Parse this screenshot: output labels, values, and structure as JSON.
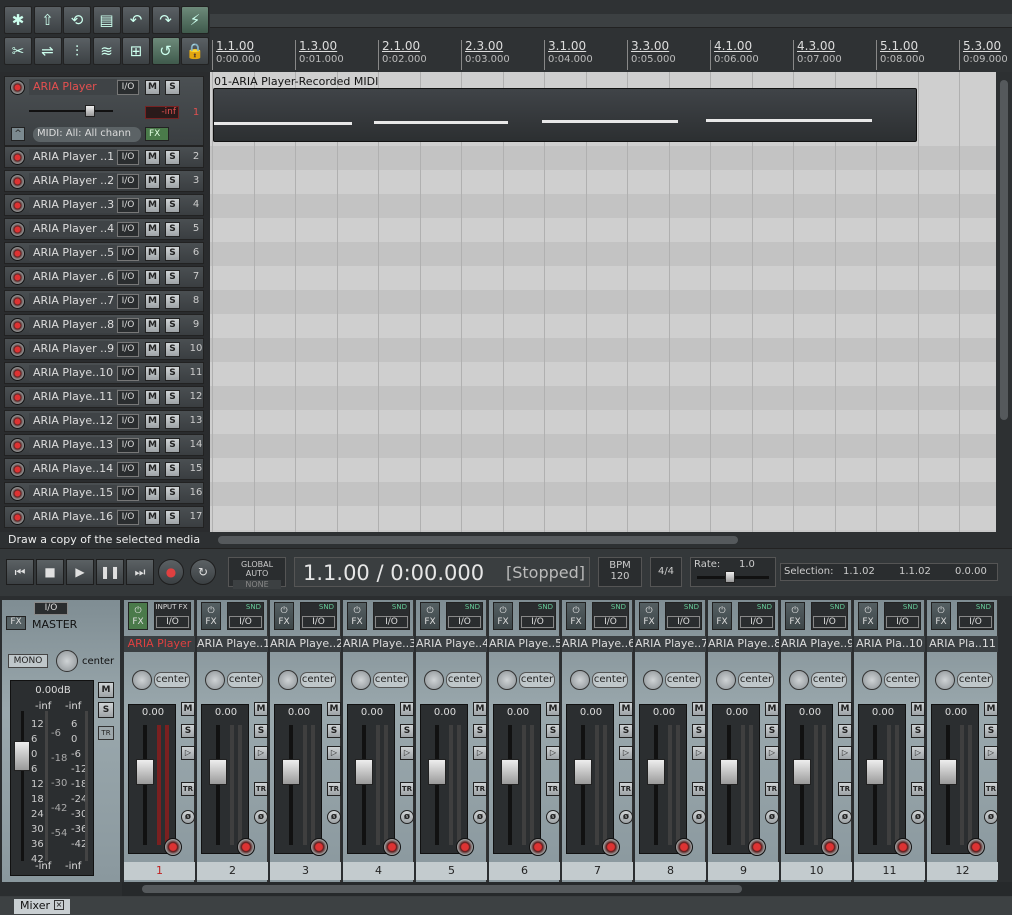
{
  "toolbar": {
    "icons": [
      "new-project",
      "open-project",
      "save-project",
      "project-settings",
      "undo",
      "redo",
      "auto-crossfade",
      "snap",
      "ripple-edit",
      "grid",
      "locking",
      "metronome",
      "loop",
      "lock"
    ]
  },
  "ruler": {
    "ticks": [
      {
        "bar": "1.1.00",
        "time": "0:00.000"
      },
      {
        "bar": "1.3.00",
        "time": "0:01.000"
      },
      {
        "bar": "2.1.00",
        "time": "0:02.000"
      },
      {
        "bar": "2.3.00",
        "time": "0:03.000"
      },
      {
        "bar": "3.1.00",
        "time": "0:04.000"
      },
      {
        "bar": "3.3.00",
        "time": "0:05.000"
      },
      {
        "bar": "4.1.00",
        "time": "0:06.000"
      },
      {
        "bar": "4.3.00",
        "time": "0:07.000"
      },
      {
        "bar": "5.1.00",
        "time": "0:08.000"
      },
      {
        "bar": "5.3.00",
        "time": "0:09.000"
      }
    ]
  },
  "track1": {
    "name": "ARIA Player",
    "io": "I/O",
    "mute": "M",
    "solo": "S",
    "number": "1",
    "vol": "-inf",
    "midi_input": "MIDI: All: All chann",
    "fx": "FX"
  },
  "tracks": [
    {
      "name": "ARIA Player ..1",
      "number": "2"
    },
    {
      "name": "ARIA Player ..2",
      "number": "3"
    },
    {
      "name": "ARIA Player ..3",
      "number": "4"
    },
    {
      "name": "ARIA Player ..4",
      "number": "5"
    },
    {
      "name": "ARIA Player ..5",
      "number": "6"
    },
    {
      "name": "ARIA Player ..6",
      "number": "7"
    },
    {
      "name": "ARIA Player ..7",
      "number": "8"
    },
    {
      "name": "ARIA Player ..8",
      "number": "9"
    },
    {
      "name": "ARIA Player ..9",
      "number": "10"
    },
    {
      "name": "ARIA Playe..10",
      "number": "11"
    },
    {
      "name": "ARIA Playe..11",
      "number": "12"
    },
    {
      "name": "ARIA Playe..12",
      "number": "13"
    },
    {
      "name": "ARIA Playe..13",
      "number": "14"
    },
    {
      "name": "ARIA Playe..14",
      "number": "15"
    },
    {
      "name": "ARIA Playe..15",
      "number": "16"
    },
    {
      "name": "ARIA Playe..16",
      "number": "17"
    }
  ],
  "item": {
    "label": "01-ARIA Player-Recorded MIDI"
  },
  "status": {
    "text": "Draw a copy of the selected media item"
  },
  "transport": {
    "global_auto": "GLOBAL AUTO",
    "global_auto_mode": "NONE",
    "position": "1.1.00 / 0:00.000",
    "state": "[Stopped]",
    "bpm_label": "BPM",
    "bpm": "120",
    "time_sig": "4/4",
    "rate_label": "Rate:",
    "rate": "1.0",
    "selection_label": "Selection:",
    "sel_start": "1.1.02",
    "sel_end": "1.1.02",
    "sel_len": "0.0.00"
  },
  "master": {
    "label": "MASTER",
    "fx": "FX",
    "io": "I/O",
    "mono": "MONO",
    "pan": "center",
    "vol": "0.00dB",
    "peak_l": "-inf",
    "peak_r": "-inf",
    "bottom_l": "-inf",
    "bottom_r": "-inf",
    "mute": "M",
    "solo": "S",
    "tr": "TR",
    "scale_left": [
      "12",
      "6",
      "0",
      "6",
      "12",
      "18",
      "24",
      "30",
      "36",
      "42"
    ],
    "scale_mid": [
      "-6",
      "-18",
      "-30",
      "-42",
      "-54"
    ],
    "scale_right": [
      "6",
      "0",
      "-6",
      "-12",
      "-18",
      "-24",
      "-30",
      "-36",
      "-42"
    ]
  },
  "mixer": {
    "tab": "Mixer",
    "input_fx": "INPUT FX",
    "snd": "SND",
    "strips": [
      {
        "name": "ARIA Player",
        "number": "1",
        "vol": "0.00",
        "pan": "center"
      },
      {
        "name": "ARIA Playe..1",
        "number": "2",
        "vol": "0.00",
        "pan": "center"
      },
      {
        "name": "ARIA Playe..2",
        "number": "3",
        "vol": "0.00",
        "pan": "center"
      },
      {
        "name": "ARIA Playe..3",
        "number": "4",
        "vol": "0.00",
        "pan": "center"
      },
      {
        "name": "ARIA Playe..4",
        "number": "5",
        "vol": "0.00",
        "pan": "center"
      },
      {
        "name": "ARIA Playe..5",
        "number": "6",
        "vol": "0.00",
        "pan": "center"
      },
      {
        "name": "ARIA Playe..6",
        "number": "7",
        "vol": "0.00",
        "pan": "center"
      },
      {
        "name": "ARIA Playe..7",
        "number": "8",
        "vol": "0.00",
        "pan": "center"
      },
      {
        "name": "ARIA Playe..8",
        "number": "9",
        "vol": "0.00",
        "pan": "center"
      },
      {
        "name": "ARIA Playe..9",
        "number": "10",
        "vol": "0.00",
        "pan": "center"
      },
      {
        "name": "ARIA Pla..10",
        "number": "11",
        "vol": "0.00",
        "pan": "center"
      },
      {
        "name": "ARIA Pla..11",
        "number": "12",
        "vol": "0.00",
        "pan": "center"
      }
    ]
  },
  "colors": {
    "accent_red": "#e04040",
    "record": "#d33"
  }
}
